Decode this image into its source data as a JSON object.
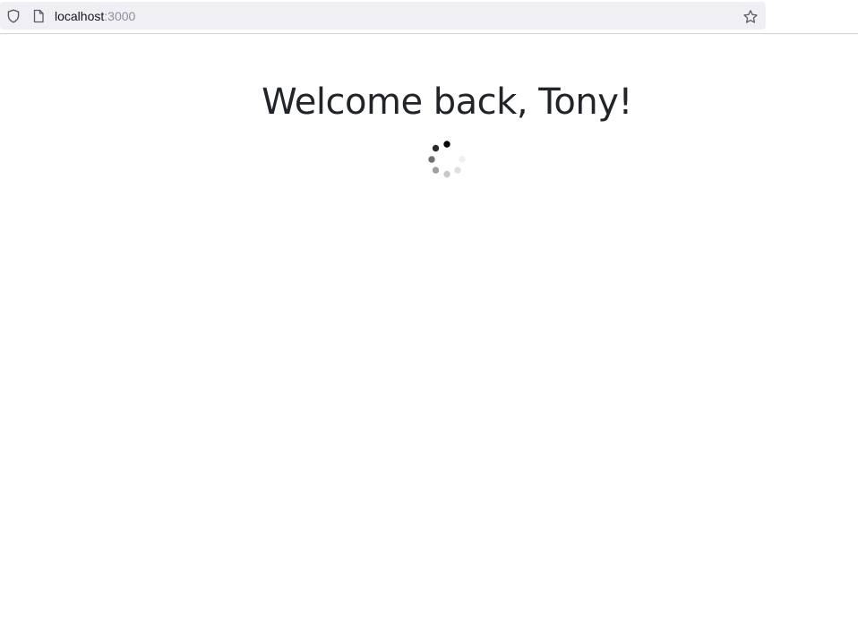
{
  "browser": {
    "url_host": "localhost",
    "url_port": ":3000",
    "icons": {
      "left": "shield-icon",
      "page": "page-icon",
      "right": "star-icon"
    }
  },
  "page": {
    "title": "Welcome back, Tony!",
    "loading_indicator": "spinner-icon"
  }
}
